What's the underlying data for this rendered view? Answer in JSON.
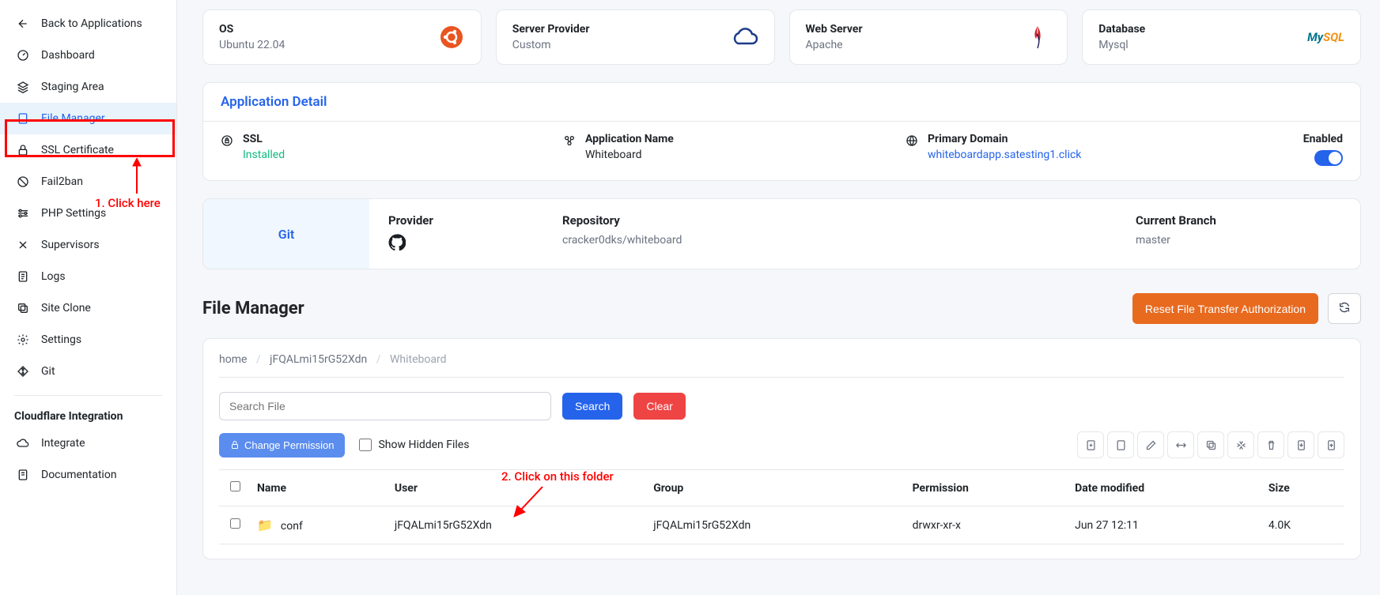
{
  "sidebar": {
    "back": "Back to Applications",
    "items": [
      {
        "label": "Dashboard"
      },
      {
        "label": "Staging Area"
      },
      {
        "label": "File Manager"
      },
      {
        "label": "SSL Certificate"
      },
      {
        "label": "Fail2ban"
      },
      {
        "label": "PHP Settings"
      },
      {
        "label": "Supervisors"
      },
      {
        "label": "Logs"
      },
      {
        "label": "Site Clone"
      },
      {
        "label": "Settings"
      },
      {
        "label": "Git"
      }
    ],
    "cloudflare_heading": "Cloudflare Integration",
    "cloudflare_items": [
      {
        "label": "Integrate"
      },
      {
        "label": "Documentation"
      }
    ]
  },
  "cards": {
    "os": {
      "title": "OS",
      "value": "Ubuntu 22.04"
    },
    "provider": {
      "title": "Server Provider",
      "value": "Custom"
    },
    "webserver": {
      "title": "Web Server",
      "value": "Apache"
    },
    "database": {
      "title": "Database",
      "value": "Mysql",
      "brand": "MySQL"
    }
  },
  "app_detail": {
    "heading": "Application Detail",
    "ssl": {
      "label": "SSL",
      "value": "Installed"
    },
    "appname": {
      "label": "Application Name",
      "value": "Whiteboard"
    },
    "domain": {
      "label": "Primary Domain",
      "value": "whiteboardapp.satesting1.click"
    },
    "enabled": "Enabled"
  },
  "git": {
    "tab": "Git",
    "provider": "Provider",
    "repo_label": "Repository",
    "repo_value": "cracker0dks/whiteboard",
    "branch_label": "Current Branch",
    "branch_value": "master"
  },
  "fm": {
    "title": "File Manager",
    "reset_btn": "Reset File Transfer Authorization",
    "breadcrumb": {
      "home": "home",
      "user": "jFQALmi15rG52Xdn",
      "current": "Whiteboard"
    },
    "search_placeholder": "Search File",
    "search_btn": "Search",
    "clear_btn": "Clear",
    "change_perm": "Change Permission",
    "show_hidden": "Show Hidden Files",
    "headers": {
      "name": "Name",
      "user": "User",
      "group": "Group",
      "perm": "Permission",
      "date": "Date modified",
      "size": "Size"
    },
    "rows": [
      {
        "name": "conf",
        "user": "jFQALmi15rG52Xdn",
        "group": "jFQALmi15rG52Xdn",
        "perm": "drwxr-xr-x",
        "date": "Jun 27 12:11",
        "size": "4.0K"
      }
    ]
  },
  "annotations": {
    "a1": "1. Click here",
    "a2": "2. Click on this folder"
  }
}
